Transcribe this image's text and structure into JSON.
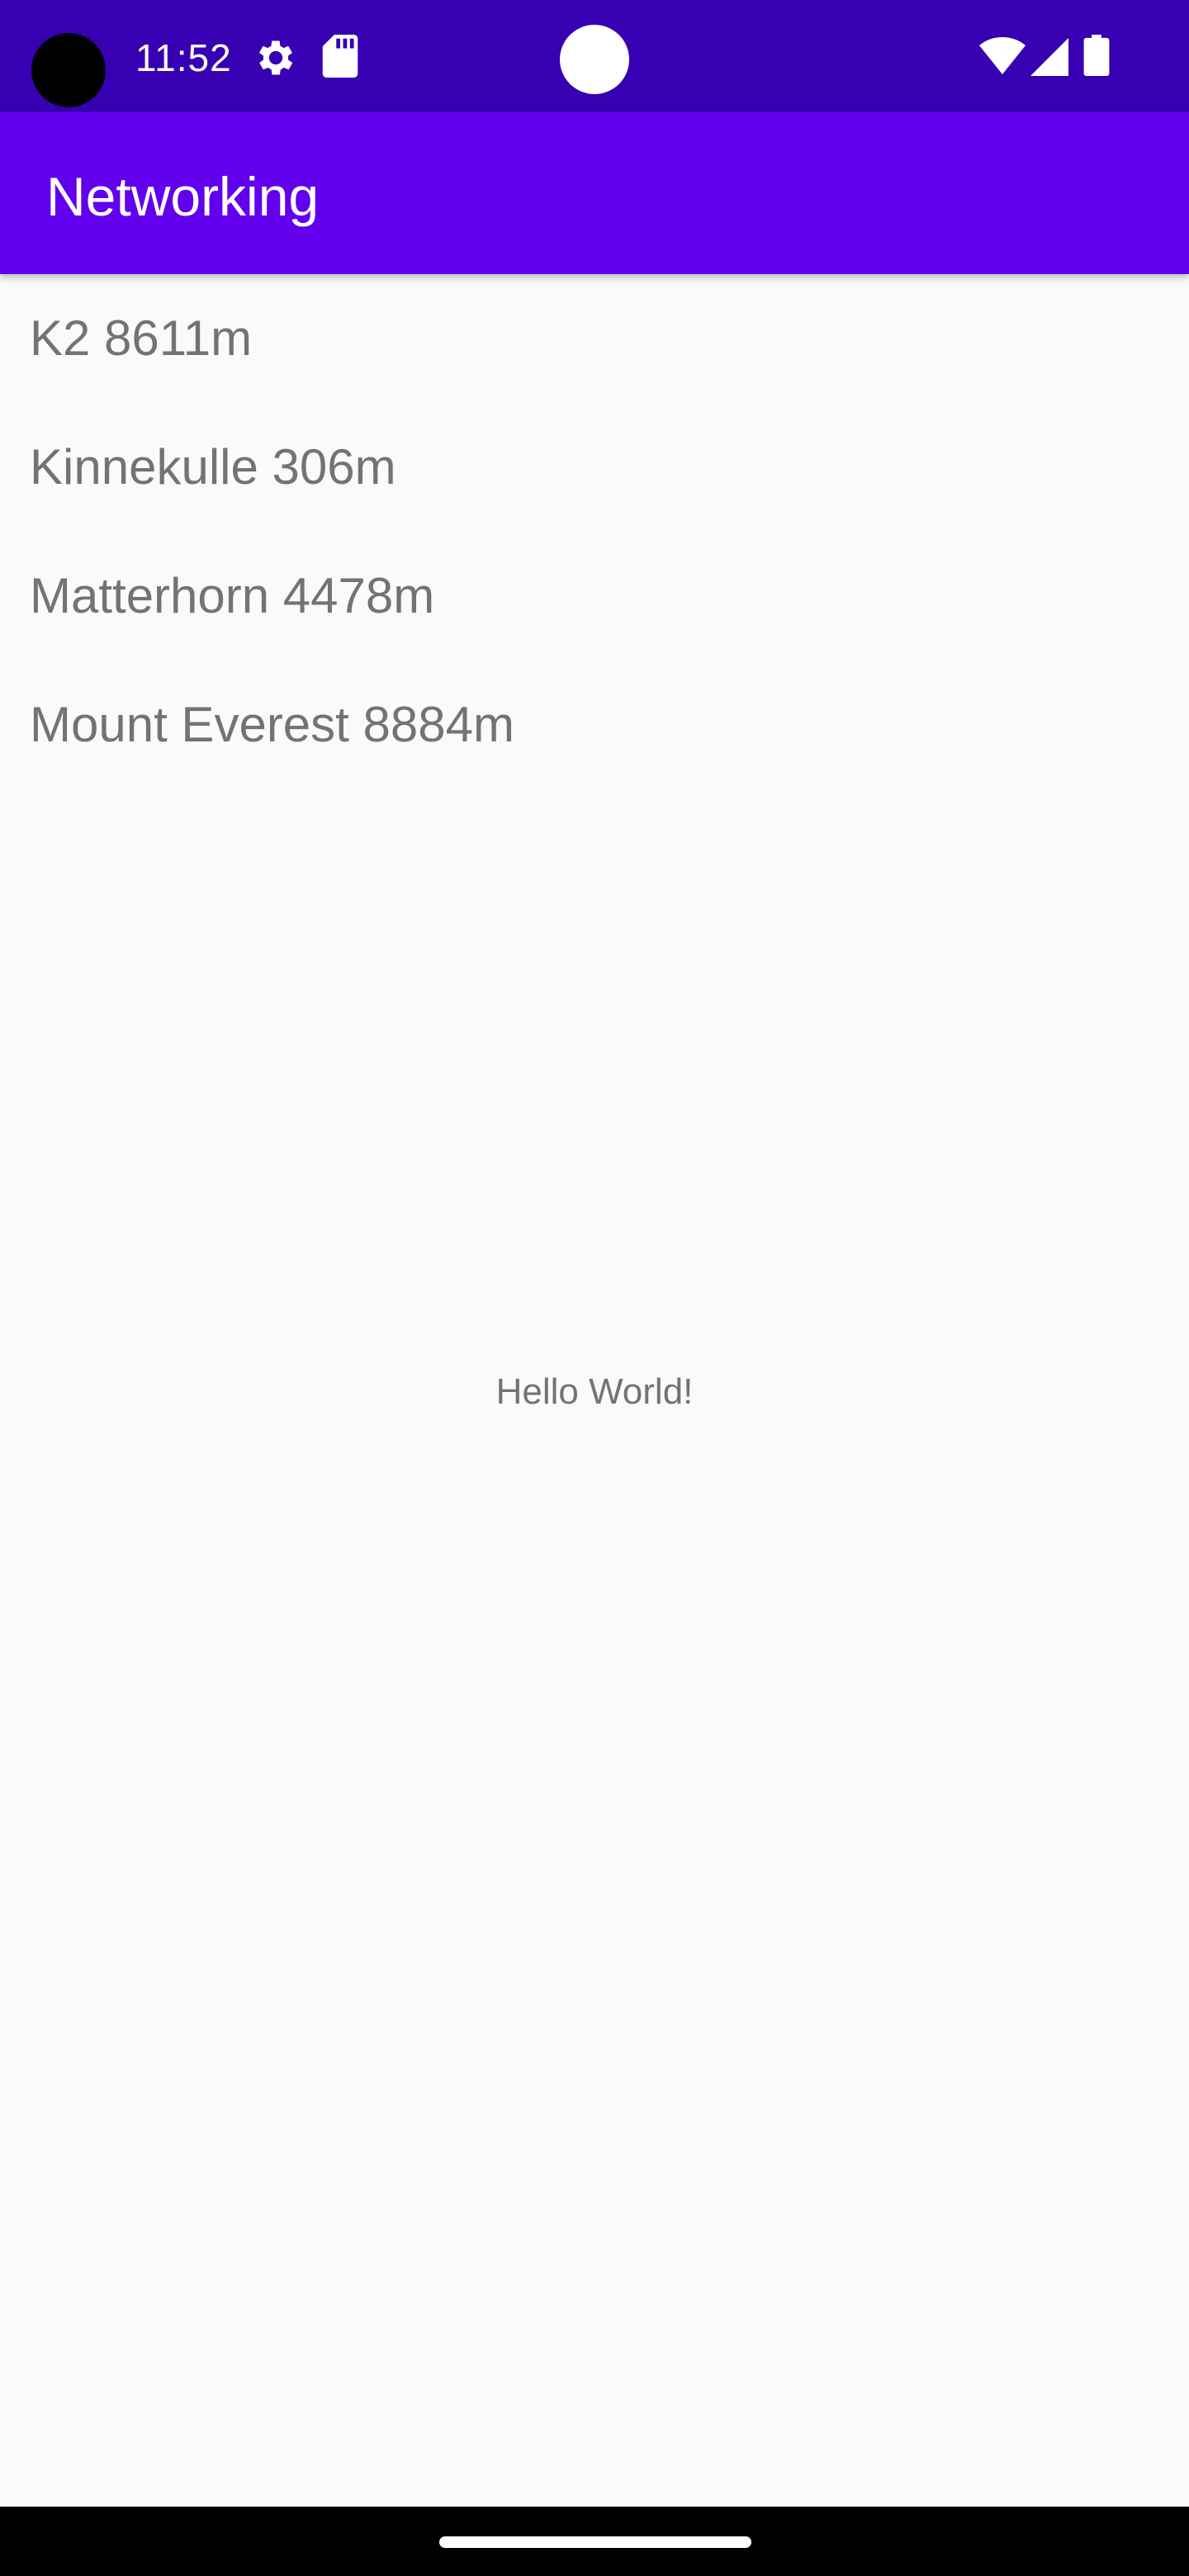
{
  "status_bar": {
    "time": "11:52",
    "icons": [
      "settings-icon",
      "sd-card-icon",
      "wifi-icon",
      "signal-icon",
      "battery-icon"
    ]
  },
  "app_bar": {
    "title": "Networking",
    "color": "#6200ee"
  },
  "mountains": [
    {
      "label": "K2 8611m"
    },
    {
      "label": "Kinnekulle 306m"
    },
    {
      "label": "Matterhorn 4478m"
    },
    {
      "label": "Mount Everest 8884m"
    }
  ],
  "main": {
    "hello_text": "Hello World!"
  },
  "colors": {
    "status_bar": "#3700b3",
    "primary": "#6200ee",
    "background": "#fafafa",
    "text": "#737373"
  }
}
